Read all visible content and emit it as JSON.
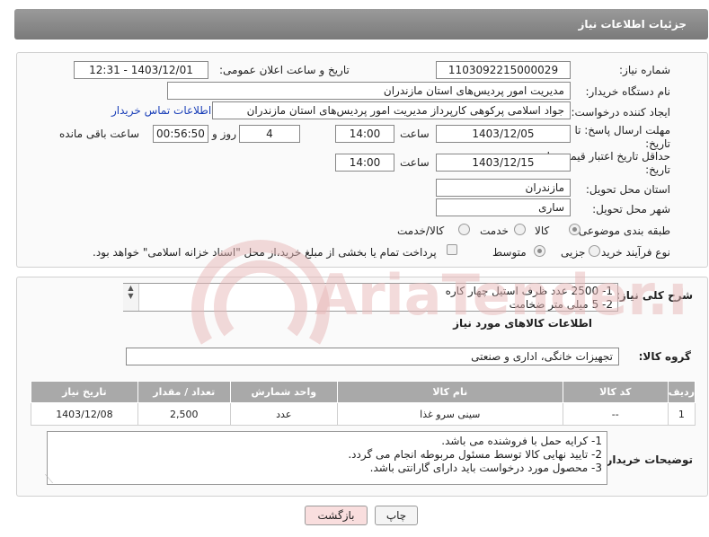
{
  "header": {
    "title": "جزئیات اطلاعات نیاز"
  },
  "form": {
    "need_number_label": "شماره نیاز:",
    "need_number": "1103092215000029",
    "announce_label": "تاریخ و ساعت اعلان عمومی:",
    "announce_value": "1403/12/01 - 12:31",
    "buyer_org_label": "نام دستگاه خریدار:",
    "buyer_org": "مدیریت امور پردیس‌های استان مازندران",
    "creator_label": "ایجاد کننده درخواست:",
    "creator": "جواد اسلامی پرکوهی کارپرداز مدیریت امور پردیس‌های استان مازندران",
    "contact_link": "اطلاعات تماس خریدار",
    "deadline_label_1": "مهلت ارسال پاسخ: تا",
    "deadline_label_2": "تاریخ:",
    "deadline_date": "1403/12/05",
    "time_label": "ساعت",
    "deadline_time": "14:00",
    "days_value": "4",
    "days_label": "روز و",
    "remaining_time": "00:56:50",
    "remaining_label": "ساعت باقی مانده",
    "validity_label_1": "حداقل تاریخ اعتبار قیمت: تا",
    "validity_label_2": "تاریخ:",
    "validity_date": "1403/12/15",
    "validity_time": "14:00",
    "province_label": "استان محل تحویل:",
    "province": "مازندران",
    "city_label": "شهر محل تحویل:",
    "city": "ساری",
    "category_label": "طبقه بندی موضوعی:",
    "category_options": [
      "کالا",
      "خدمت",
      "کالا/خدمت"
    ],
    "process_label": "نوع فرآیند خرید :",
    "process_options": [
      "جزیی",
      "متوسط"
    ],
    "treasury_text": "پرداخت تمام یا بخشی از مبلغ خرید،از محل \"اسناد خزانه اسلامی\" خواهد بود."
  },
  "description": {
    "label": "شرح کلی نیاز:",
    "lines": [
      "1- 2500 عدد ظرف استیل چهار کاره",
      "2- 5 میلی متر ضخامت"
    ]
  },
  "goods": {
    "section_title": "اطلاعات کالاهای مورد نیاز",
    "group_label": "گروه کالا:",
    "group_value": "تجهیزات خانگی، اداری و صنعتی",
    "columns": [
      "ردیف",
      "کد کالا",
      "نام کالا",
      "واحد شمارش",
      "تعداد / مقدار",
      "تاریخ نیاز"
    ],
    "rows": [
      [
        "1",
        "--",
        "سینی سرو غذا",
        "عدد",
        "2,500",
        "1403/12/08"
      ]
    ]
  },
  "buyer_notes": {
    "label": "توضیحات خریدار:",
    "lines": [
      "1- کرایه حمل با فروشنده می باشد.",
      "2- تایید نهایی کالا توسط مسئول مربوطه انجام می گردد.",
      "3- محصول مورد درخواست باید دارای گارانتی باشد."
    ]
  },
  "buttons": {
    "print": "چاپ",
    "back": "بازگشت"
  },
  "watermark": "AriaTender.net",
  "colors": {
    "header_bg": "#8a8a8a",
    "link": "#1a3fb8",
    "back_button_bg": "#f9dede",
    "watermark": "#e8b8b8"
  }
}
